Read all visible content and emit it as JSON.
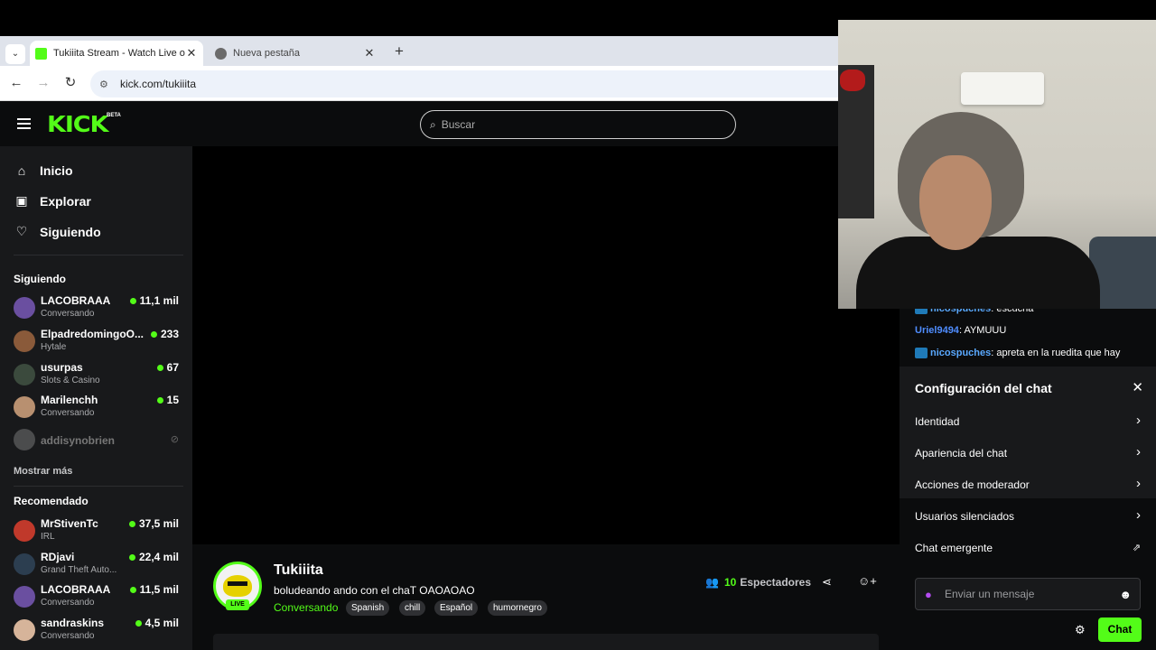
{
  "browser": {
    "tabs": [
      {
        "title": "Tukiiita Stream - Watch Live on",
        "active": true,
        "favicon_color": "#53fc18"
      },
      {
        "title": "Nueva pestaña",
        "active": false,
        "favicon_color": "#6b6b6b"
      }
    ],
    "url": "kick.com/tukiiita"
  },
  "header": {
    "logo": "KICK",
    "logo_badge": "BETA",
    "search_placeholder": "Buscar"
  },
  "sidebar": {
    "nav": [
      {
        "label": "Inicio",
        "icon": "home-icon"
      },
      {
        "label": "Explorar",
        "icon": "compass-icon"
      },
      {
        "label": "Siguiendo",
        "icon": "heart-icon"
      }
    ],
    "following_header": "Siguiendo",
    "following": [
      {
        "name": "LACOBRAAA",
        "category": "Conversando",
        "viewers": "11,1 mil",
        "avatar_color": "#6a4fa0"
      },
      {
        "name": "ElpadredomingoO...",
        "category": "Hytale",
        "viewers": "233",
        "avatar_color": "#8a5a3a"
      },
      {
        "name": "usurpas",
        "category": "Slots & Casino",
        "viewers": "67",
        "avatar_color": "#3b4a3d"
      },
      {
        "name": "Marilenchh",
        "category": "Conversando",
        "viewers": "15",
        "avatar_color": "#b89070"
      },
      {
        "name": "addisynobrien",
        "category": "",
        "viewers": "",
        "offline": true,
        "avatar_color": "#999999"
      }
    ],
    "show_more": "Mostrar más",
    "recommended_header": "Recomendado",
    "recommended": [
      {
        "name": "MrStivenTc",
        "category": "IRL",
        "viewers": "37,5 mil",
        "avatar_color": "#c0392b"
      },
      {
        "name": "RDjavi",
        "category": "Grand Theft Auto...",
        "viewers": "22,4 mil",
        "avatar_color": "#2c3e50"
      },
      {
        "name": "LACOBRAAA",
        "category": "Conversando",
        "viewers": "11,5 mil",
        "avatar_color": "#6a4fa0"
      },
      {
        "name": "sandraskins",
        "category": "Conversando",
        "viewers": "4,5 mil",
        "avatar_color": "#d6b49a"
      }
    ]
  },
  "stream": {
    "streamer": "Tukiiita",
    "live_badge": "LIVE",
    "title": "boludeando ando con el chaT OAOAOAO",
    "category": "Conversando",
    "tags": [
      "Spanish",
      "chill",
      "Español",
      "humornegro"
    ],
    "viewer_count": "10",
    "viewer_label": "Espectadores"
  },
  "chat": {
    "messages": [
      {
        "user": "nicospuches",
        "text": "escucha",
        "user_color": "#5aa9ff",
        "badge": true
      },
      {
        "user": "Uriel9494",
        "text": "AYMUUU",
        "user_color": "#4f8dff",
        "badge": false
      },
      {
        "user": "nicospuches",
        "text": "apreta en la ruedita que hay",
        "user_color": "#5aa9ff",
        "badge": true
      }
    ],
    "settings": {
      "title": "Configuración del chat",
      "items": [
        {
          "label": "Identidad",
          "chevron": true
        },
        {
          "label": "Apariencia del chat",
          "chevron": true
        },
        {
          "label": "Acciones de moderador",
          "chevron": true
        },
        {
          "label": "Usuarios silenciados",
          "chevron": true
        },
        {
          "label": "Chat emergente",
          "chevron": false
        }
      ]
    },
    "input_placeholder": "Enviar un mensaje",
    "send_label": "Chat"
  },
  "colors": {
    "accent": "#53fc18",
    "bg": "#0b0c0d",
    "sidebar_bg": "#18191b"
  }
}
